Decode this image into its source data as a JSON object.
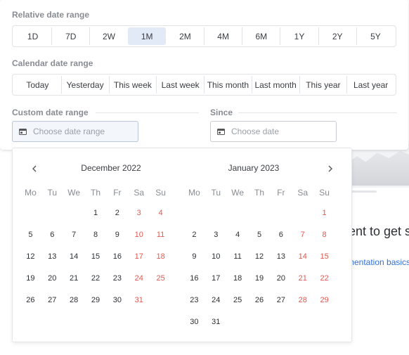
{
  "relative": {
    "title": "Relative date range",
    "options": [
      "1D",
      "7D",
      "2W",
      "1M",
      "2M",
      "4M",
      "6M",
      "1Y",
      "2Y",
      "5Y"
    ],
    "selected": "1M"
  },
  "calendar_range": {
    "title": "Calendar date range",
    "options": [
      "Today",
      "Yesterday",
      "This week",
      "Last week",
      "This month",
      "Last month",
      "This year",
      "Last year"
    ]
  },
  "custom": {
    "title": "Custom date range",
    "placeholder": "Choose date range"
  },
  "since": {
    "title": "Since",
    "placeholder": "Choose date"
  },
  "picker": {
    "weekdays": [
      "Mo",
      "Tu",
      "We",
      "Th",
      "Fr",
      "Sa",
      "Su"
    ],
    "months": [
      {
        "title": "December 2022",
        "weeks": [
          [
            "",
            "",
            "",
            "1",
            "2",
            "3",
            "4"
          ],
          [
            "5",
            "6",
            "7",
            "8",
            "9",
            "10",
            "11"
          ],
          [
            "12",
            "13",
            "14",
            "15",
            "16",
            "17",
            "18"
          ],
          [
            "19",
            "20",
            "21",
            "22",
            "23",
            "24",
            "25"
          ],
          [
            "26",
            "27",
            "28",
            "29",
            "30",
            "31",
            ""
          ]
        ]
      },
      {
        "title": "January 2023",
        "weeks": [
          [
            "",
            "",
            "",
            "",
            "",
            "",
            "1"
          ],
          [
            "2",
            "3",
            "4",
            "5",
            "6",
            "7",
            "8"
          ],
          [
            "9",
            "10",
            "11",
            "12",
            "13",
            "14",
            "15"
          ],
          [
            "16",
            "17",
            "18",
            "19",
            "20",
            "21",
            "22"
          ],
          [
            "23",
            "24",
            "25",
            "26",
            "27",
            "28",
            "29"
          ],
          [
            "30",
            "31",
            "",
            "",
            "",
            "",
            ""
          ]
        ]
      }
    ],
    "prev_icon": "chevron-left-icon",
    "next_icon": "chevron-right-icon"
  },
  "background": {
    "heading": "ent to get s",
    "link": "mentation basics"
  },
  "colors": {
    "weekend": "#e0584f",
    "selected_bg": "#e2eaf8",
    "link": "#2f6fd6"
  }
}
